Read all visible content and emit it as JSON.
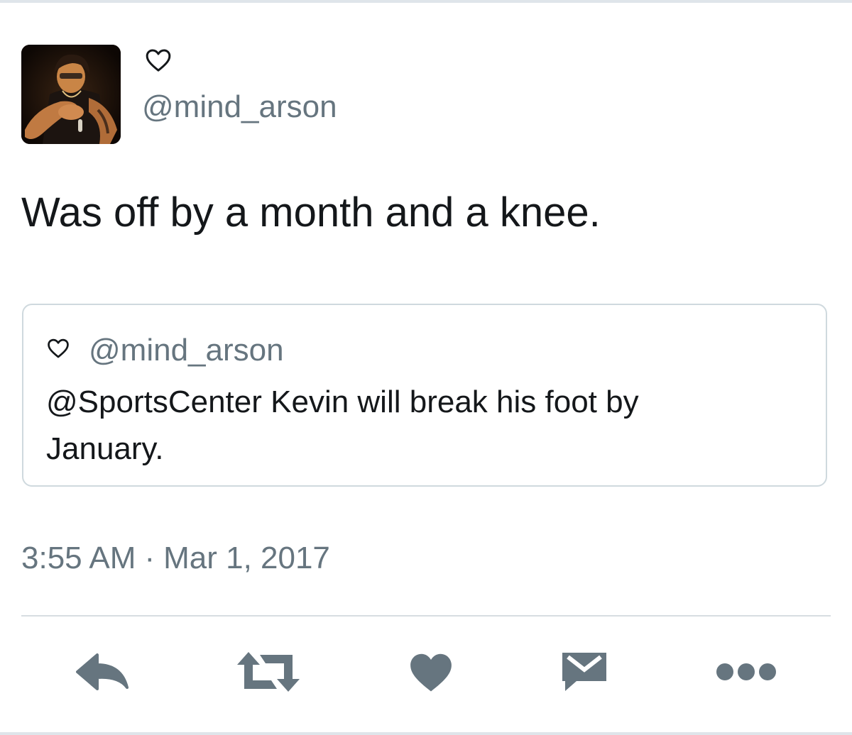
{
  "tweet": {
    "handle": "@mind_arson",
    "text": "Was off by a month and a knee.",
    "time": "3:55 AM",
    "separator": "·",
    "date": "Mar 1, 2017"
  },
  "quoted_tweet": {
    "handle": "@mind_arson",
    "text": "@SportsCenter Kevin will break his foot by January."
  },
  "actions": [
    "reply-icon",
    "retweet-icon",
    "like-icon",
    "message-icon",
    "more-icon"
  ],
  "colors": {
    "text": "#14171a",
    "secondary": "#66757f",
    "icon": "#66757f",
    "border": "#cfd9de"
  }
}
